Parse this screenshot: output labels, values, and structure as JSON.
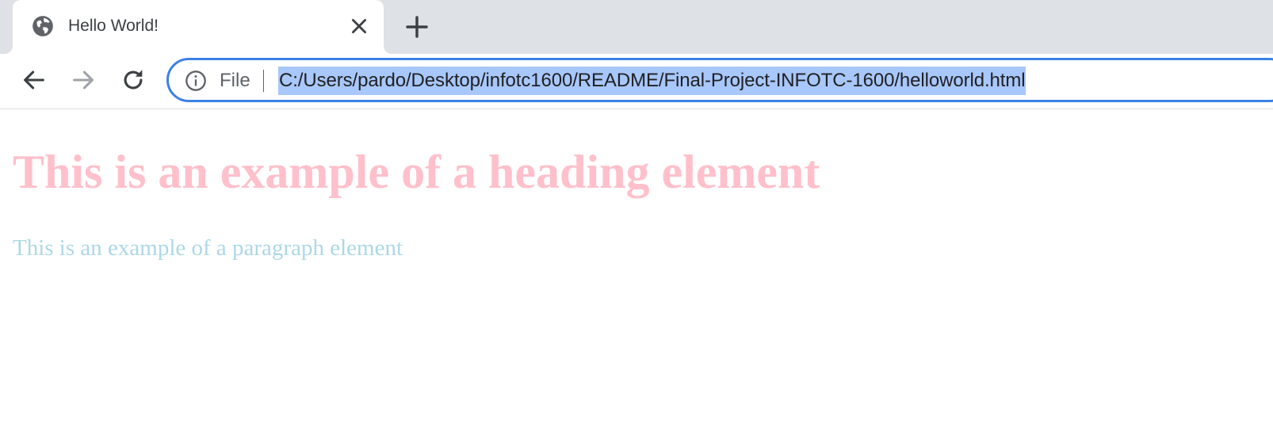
{
  "tab": {
    "title": "Hello World!",
    "favicon": "globe-icon",
    "close_icon": "close-icon"
  },
  "toolbar": {
    "new_tab_icon": "plus-icon",
    "back_icon": "back-arrow-icon",
    "forward_icon": "forward-arrow-icon",
    "reload_icon": "reload-icon"
  },
  "omnibox": {
    "info_icon": "info-icon",
    "scheme": "File",
    "url": "C:/Users/pardo/Desktop/infotc1600/README/Final-Project-INFOTC-1600/helloworld.html",
    "url_selected": true,
    "focus_color": "#3b82e6",
    "selection_color": "#a8c7fa"
  },
  "page": {
    "heading": "This is an example of a heading element",
    "heading_color": "#ffc0cb",
    "paragraph": "This is an example of a paragraph element",
    "paragraph_color": "#add8e6"
  }
}
